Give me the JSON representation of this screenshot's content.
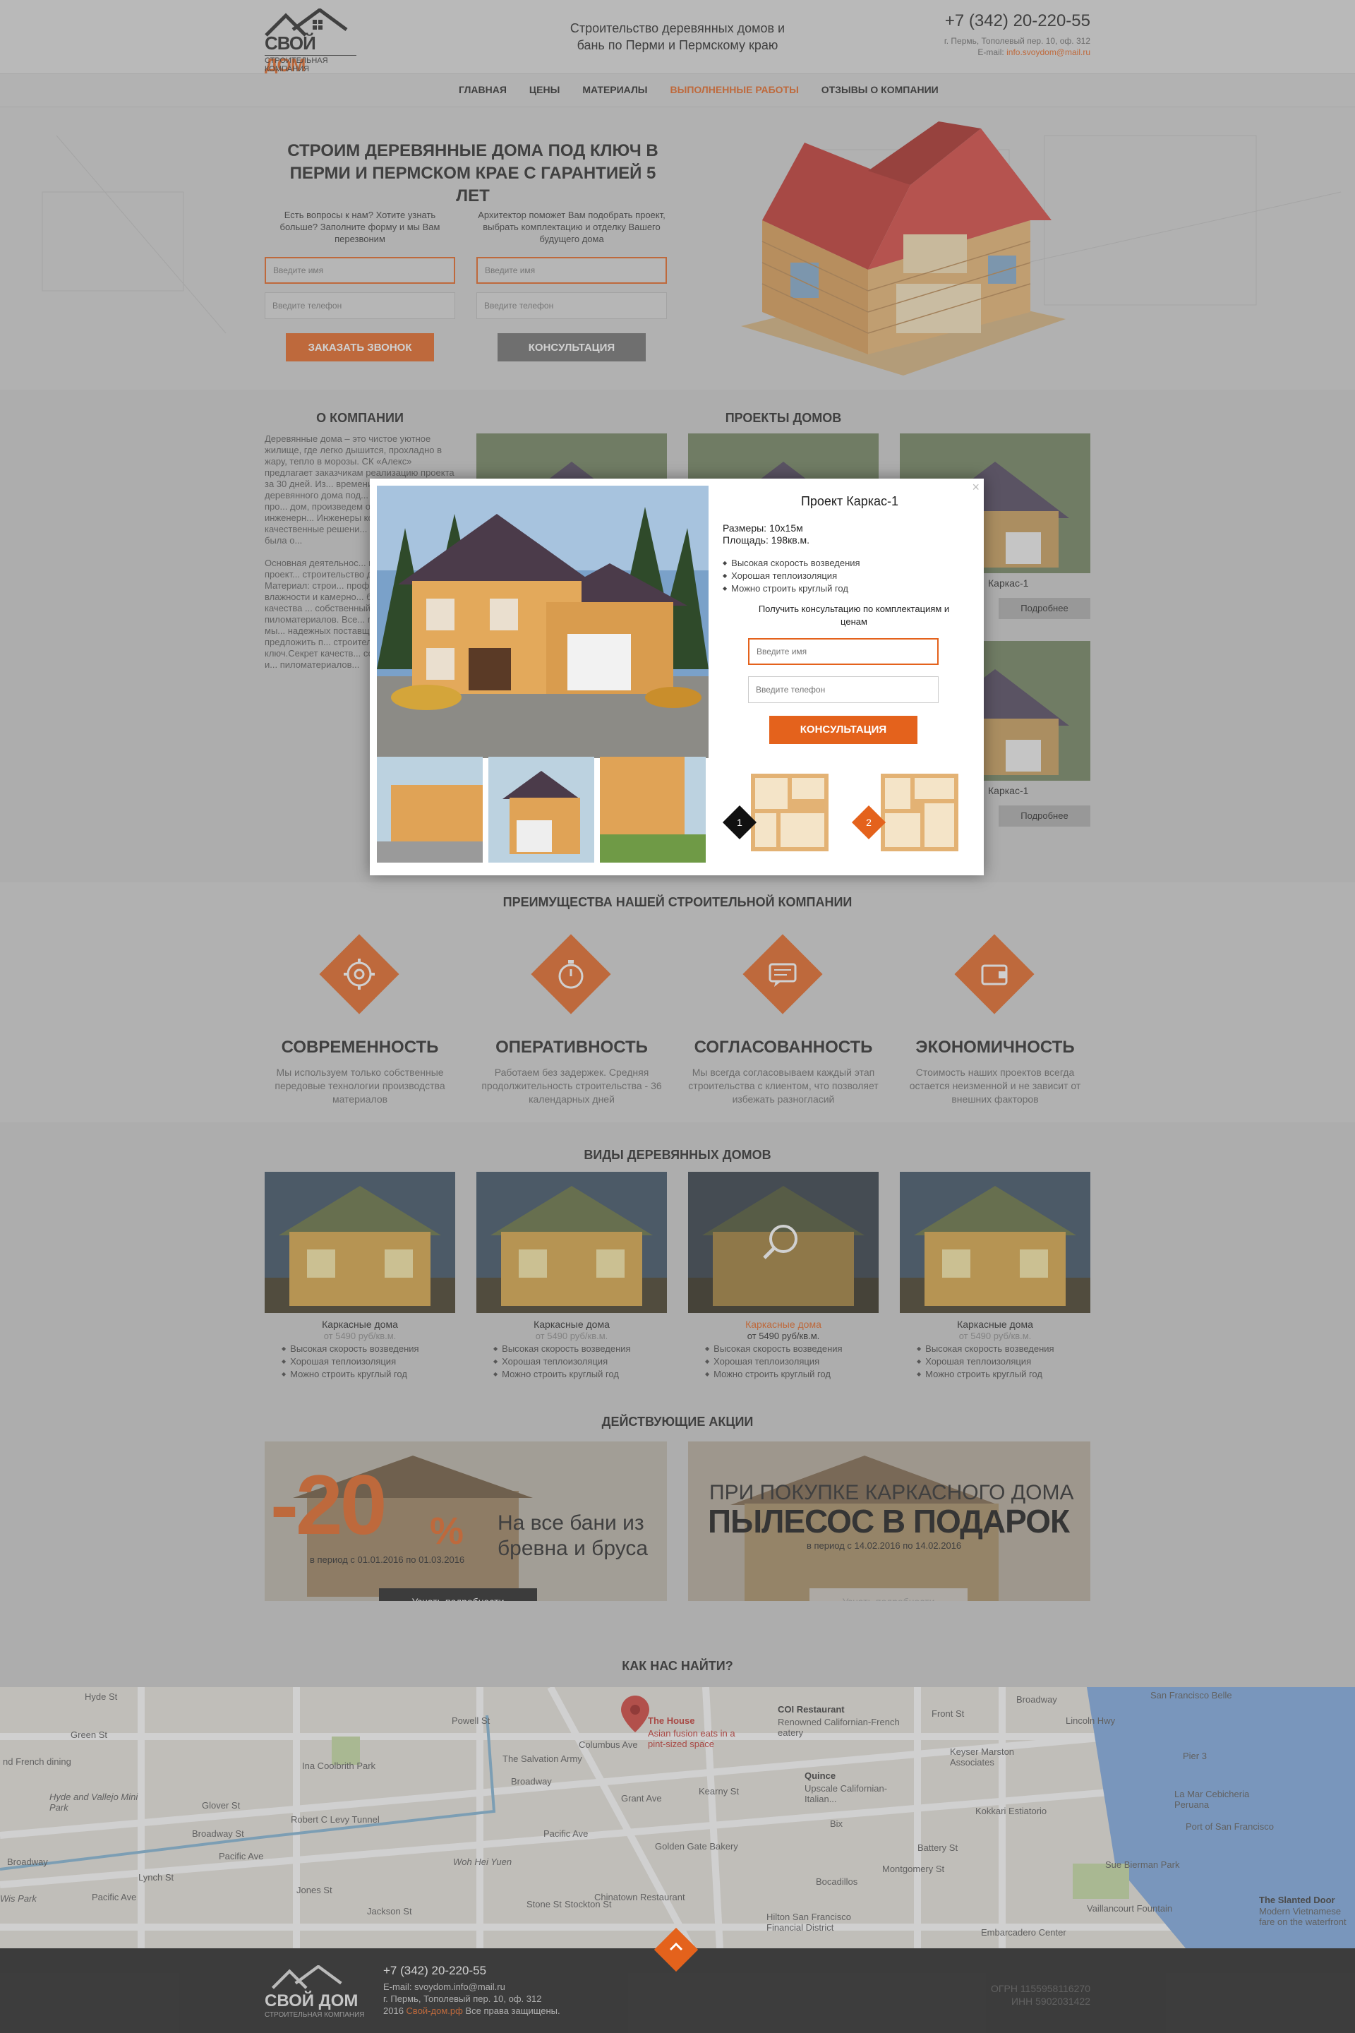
{
  "header": {
    "brand_a": "СВОЙ",
    "brand_b": "ДОМ",
    "brand_sub": "СТРОИТЕЛЬНАЯ КОМПАНИЯ",
    "tagline": "Строительство деревянных домов и бань по Перми и Пермскому краю",
    "phone": "+7 (342) 20-220-55",
    "address": "г. Пермь, Тополевый пер. 10, оф. 312",
    "email_label": "E-mail:",
    "email": "info.svoydom@mail.ru"
  },
  "nav": {
    "items": [
      {
        "label": "ГЛАВНАЯ"
      },
      {
        "label": "ЦЕНЫ"
      },
      {
        "label": "МАТЕРИАЛЫ"
      },
      {
        "label": "ВЫПОЛНЕННЫЕ РАБОТЫ",
        "active": true
      },
      {
        "label": "ОТЗЫВЫ О КОМПАНИИ"
      }
    ]
  },
  "hero": {
    "title": "СТРОИМ ДЕРЕВЯННЫЕ ДОМА ПОД КЛЮЧ В ПЕРМИ И ПЕРМСКОМ КРАЕ С ГАРАНТИЕЙ 5 ЛЕТ",
    "col1": {
      "desc": "Есть вопросы к нам? Хотите узнать больше? Заполните форму и мы Вам перезвоним",
      "name_placeholder": "Введите имя",
      "phone_placeholder": "Введите телефон",
      "button": "ЗАКАЗАТЬ ЗВОНОК"
    },
    "col2": {
      "desc": "Архитектор поможет Вам подобрать проект, выбрать комплектацию и отделку Вашего будущего дома",
      "name_placeholder": "Введите имя",
      "phone_placeholder": "Введите телефон",
      "button": "КОНСУЛЬТАЦИЯ"
    }
  },
  "about": {
    "title": "О КОМПАНИИ",
    "text_1": "Деревянные дома – это чистое уютное жилище, где легко дышится, прохладно в жару, тепло в морозы. СК «Алекс» предлагает заказчикам реализацию проекта за 30 дней. Из... времени займет строи... деревянного дома под... разработаем вам про... дом, произведем обст... установим инженерн... Инженеры компании с... качественные решени... строительство была о...",
    "text_2": "Основная деятельнос... производство, проект... строительство домов... ключ. Материал: строи... профилированный бру... влажности и камерно... брус.Секрет качества ... собственный цех по и... пиломатериалов. Все... производим сами, мы... надежных поставщик... можем предложить п... строительство малоэт... ключ.Секрет качеств... собственный цех по и... пиломатериалов..."
  },
  "projects": {
    "title": "ПРОЕКТЫ ДОМОВ",
    "items": [
      {
        "name": "Каркас-1",
        "more": "Подробнее"
      },
      {
        "name": "Каркас-1",
        "more": "Подробнее"
      }
    ]
  },
  "modal": {
    "title": "Проект Каркас-1",
    "size": "Размеры: 10х15м",
    "area": "Площадь: 198кв.м.",
    "features": [
      "Высокая скорость возведения",
      "Хорошая теплоизоляция",
      "Можно строить круглый год"
    ],
    "get_consult": "Получить консультацию по комплектациям и ценам",
    "name_placeholder": "Введите имя",
    "phone_placeholder": "Введите телефон",
    "button": "КОНСУЛЬТАЦИЯ",
    "plan_1": "1",
    "plan_2": "2",
    "close": "×"
  },
  "advantages": {
    "title": "ПРЕИМУЩЕСТВА НАШЕЙ СТРОИТЕЛЬНОЙ КОМПАНИИ",
    "items": [
      {
        "title": "СОВРЕМЕННОСТЬ",
        "text": "Мы используем только собственные передовые технологии производства материалов",
        "icon": "gear-icon"
      },
      {
        "title": "ОПЕРАТИВНОСТЬ",
        "text": "Работаем без задержек. Средняя продолжительность строительства - 36 календарных дней",
        "icon": "stopwatch-icon"
      },
      {
        "title": "СОГЛАСОВАННОСТЬ",
        "text": "Мы всегда согласовываем каждый этап строительства с клиентом, что позволяет избежать разногласий",
        "icon": "chat-icon"
      },
      {
        "title": "ЭКОНОМИЧНОСТЬ",
        "text": "Стоимость наших проектов всегда остается неизменной и не зависит от внешних факторов",
        "icon": "wallet-icon"
      }
    ]
  },
  "types": {
    "title": "ВИДЫ ДЕРЕВЯННЫХ ДОМОВ",
    "items": [
      {
        "name": "Каркасные дома",
        "price": "от 5490 руб/кв.м."
      },
      {
        "name": "Каркасные дома",
        "price": "от 5490 руб/кв.м."
      },
      {
        "name": "Каркасные дома",
        "price": "от 5490 руб/кв.м.",
        "active": true
      },
      {
        "name": "Каркасные дома",
        "price": "от 5490 руб/кв.м."
      }
    ],
    "features": [
      "Высокая скорость возведения",
      "Хорошая теплоизоляция",
      "Можно строить круглый год"
    ]
  },
  "promos": {
    "title": "ДЕЙСТВУЮЩИЕ АКЦИИ",
    "p1": {
      "big": "-20",
      "pct": "%",
      "text": "На все бани из бревна и бруса",
      "period": "в период с 01.01.2016 по 01.03.2016",
      "button": "Узнать подробности"
    },
    "p2": {
      "line1": "ПРИ ПОКУПКЕ КАРКАСНОГО ДОМА",
      "line2": "ПЫЛЕСОС В ПОДАРОК",
      "period": "в период с 14.02.2016 по 14.02.2016",
      "button": "Узнать подробности"
    }
  },
  "map": {
    "title": "КАК НАС НАЙТИ?",
    "labels": [
      "Hyde St",
      "Green St",
      "nd French dining",
      "Ina Coolbrith Park",
      "Hyde and Vallejo Mini Park",
      "Glover St",
      "Broadway St",
      "Robert C Levy Tunnel",
      "Pacific Ave",
      "Broadway",
      "Lynch St",
      "Jones St",
      "Pacific Ave",
      "Woh Hei Yuen",
      "Jackson St",
      "Wis Park",
      "The Salvation Army",
      "Powell St",
      "Columbus Ave",
      "Grant Ave",
      "Broadway",
      "Pacific Ave",
      "Stone St",
      "Stockton St",
      "Chinatown Restaurant",
      "Golden Gate Bakery",
      "Kearny St",
      "COI Restaurant",
      "Renowned Californian-French eatery",
      "Quince",
      "Upscale Californian-Italian...",
      "Bix",
      "Bocadillos",
      "Hilton San Francisco Financial District",
      "Montgomery St",
      "Keyser Marston Associates",
      "Kokkari Estiatorio",
      "Battery St",
      "Front St",
      "Embarcadero Center",
      "Broadway",
      "Lincoln Hwy",
      "San Francisco Belle",
      "Pier 3",
      "La Mar Cebicheria Peruana",
      "Port of San Francisco",
      "Sue Bierman Park",
      "Vaillancourt Fountain",
      "The Slanted Door",
      "Modern Vietnamese fare on the waterfront"
    ],
    "pin_title": "The House",
    "pin_desc": "Asian fusion eats in a pint-sized space"
  },
  "footer": {
    "phone": "+7 (342) 20-220-55",
    "email": "E-mail: svoydom.info@mail.ru",
    "address": "г. Пермь, Тополевый пер. 10, оф. 312",
    "copy_a": "2016",
    "copy_link": "Свой-дом.рф",
    "copy_b": "Все права защищены.",
    "ogrn": "ОГРН 1155958116270",
    "inn": "ИНН 5902031422"
  },
  "colors": {
    "accent": "#e4621c",
    "dark": "#1d1d1d"
  }
}
